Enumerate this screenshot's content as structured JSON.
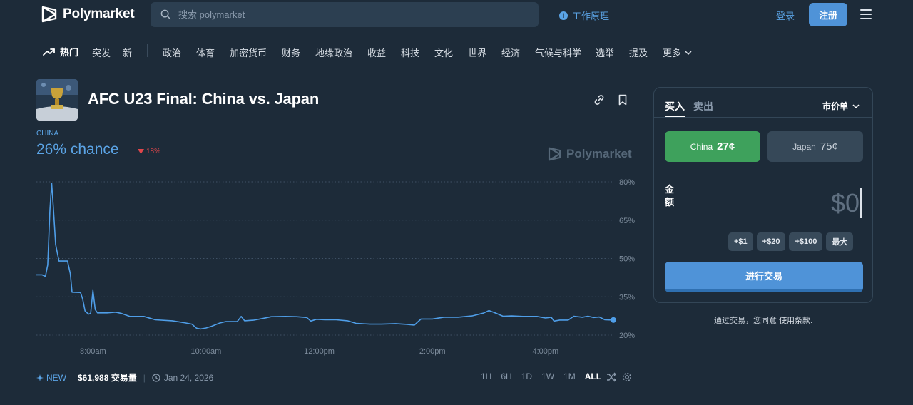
{
  "header": {
    "logo_text": "Polymarket",
    "search_placeholder": "搜索 polymarket",
    "how_it_works": "工作原理",
    "login": "登录",
    "signup": "注册"
  },
  "categories": {
    "hot": "热门",
    "items": [
      "突发",
      "新",
      "政治",
      "体育",
      "加密货币",
      "财务",
      "地缘政治",
      "收益",
      "科技",
      "文化",
      "世界",
      "经济",
      "气候与科学",
      "选举",
      "提及",
      "更多"
    ]
  },
  "market": {
    "title": "AFC U23 Final: China vs. Japan",
    "outcome": "CHINA",
    "chance": "26% chance",
    "delta": "18%",
    "watermark": "Polymarket",
    "new_label": "NEW",
    "volume": "$61,988 交易量",
    "date": "Jan 24, 2026",
    "ranges": [
      "1H",
      "6H",
      "1D",
      "1W",
      "1M",
      "ALL"
    ],
    "active_range": "ALL"
  },
  "chart_data": {
    "type": "line",
    "series": [
      {
        "color": "#4f9ee8",
        "points": [
          [
            7.0,
            43.6
          ],
          [
            7.1,
            43.6
          ],
          [
            7.16,
            43.0
          ],
          [
            7.2,
            47.5
          ],
          [
            7.24,
            69.0
          ],
          [
            7.27,
            79.5
          ],
          [
            7.3,
            70.0
          ],
          [
            7.34,
            55.5
          ],
          [
            7.4,
            49.0
          ],
          [
            7.55,
            49.0
          ],
          [
            7.6,
            44.0
          ],
          [
            7.63,
            36.8
          ],
          [
            7.78,
            36.7
          ],
          [
            7.82,
            34.0
          ],
          [
            7.86,
            29.5
          ],
          [
            7.92,
            28.2
          ],
          [
            7.96,
            28.5
          ],
          [
            8.0,
            37.5
          ],
          [
            8.04,
            30.0
          ],
          [
            8.08,
            28.7
          ],
          [
            8.25,
            28.7
          ],
          [
            8.4,
            29.0
          ],
          [
            8.5,
            28.5
          ],
          [
            8.65,
            27.3
          ],
          [
            8.9,
            27.3
          ],
          [
            9.1,
            26.0
          ],
          [
            9.4,
            25.6
          ],
          [
            9.6,
            24.9
          ],
          [
            9.75,
            24.3
          ],
          [
            9.83,
            22.7
          ],
          [
            9.9,
            22.4
          ],
          [
            10.0,
            22.8
          ],
          [
            10.1,
            23.5
          ],
          [
            10.25,
            24.8
          ],
          [
            10.35,
            25.3
          ],
          [
            10.55,
            25.3
          ],
          [
            10.62,
            27.3
          ],
          [
            10.68,
            25.6
          ],
          [
            10.85,
            25.9
          ],
          [
            11.0,
            26.5
          ],
          [
            11.15,
            27.2
          ],
          [
            11.4,
            27.3
          ],
          [
            11.6,
            27.2
          ],
          [
            11.78,
            26.9
          ],
          [
            11.85,
            25.5
          ],
          [
            11.95,
            26.2
          ],
          [
            12.1,
            26.0
          ],
          [
            12.3,
            26.0
          ],
          [
            12.5,
            25.6
          ],
          [
            12.65,
            24.6
          ],
          [
            12.9,
            24.3
          ],
          [
            13.1,
            24.3
          ],
          [
            13.35,
            24.5
          ],
          [
            13.55,
            24.2
          ],
          [
            13.68,
            23.9
          ],
          [
            13.8,
            26.3
          ],
          [
            14.0,
            26.3
          ],
          [
            14.2,
            27.0
          ],
          [
            14.45,
            27.0
          ],
          [
            14.7,
            27.5
          ],
          [
            14.9,
            28.6
          ],
          [
            15.0,
            29.6
          ],
          [
            15.1,
            28.8
          ],
          [
            15.25,
            27.4
          ],
          [
            15.4,
            27.5
          ],
          [
            15.6,
            27.3
          ],
          [
            15.85,
            27.3
          ],
          [
            16.0,
            26.7
          ],
          [
            16.1,
            27.0
          ],
          [
            16.15,
            25.5
          ],
          [
            16.25,
            25.9
          ],
          [
            16.4,
            25.9
          ],
          [
            16.5,
            27.4
          ],
          [
            16.65,
            27.0
          ],
          [
            16.75,
            27.4
          ],
          [
            16.85,
            26.9
          ],
          [
            16.95,
            27.1
          ],
          [
            17.05,
            26.0
          ],
          [
            17.2,
            25.9
          ]
        ]
      }
    ],
    "x_ticks": [
      {
        "label": "8:00am",
        "value": 8
      },
      {
        "label": "10:00am",
        "value": 10
      },
      {
        "label": "12:00pm",
        "value": 12
      },
      {
        "label": "2:00pm",
        "value": 14
      },
      {
        "label": "4:00pm",
        "value": 16
      }
    ],
    "y_ticks": [
      {
        "label": "80%",
        "value": 80
      },
      {
        "label": "65%",
        "value": 65
      },
      {
        "label": "50%",
        "value": 50
      },
      {
        "label": "35%",
        "value": 35
      },
      {
        "label": "20%",
        "value": 20
      }
    ],
    "xlim": [
      7.0,
      17.2
    ],
    "ylim": [
      20,
      80
    ],
    "grid": true,
    "last_value": 25.9
  },
  "trade": {
    "buy_tab": "买入",
    "sell_tab": "卖出",
    "order_type": "市价单",
    "outcome_yes": {
      "name": "China",
      "price": "27¢"
    },
    "outcome_no": {
      "name": "Japan",
      "price": "75¢"
    },
    "amount_label": "金额",
    "amount_value": "$0",
    "quick_amounts": [
      "+$1",
      "+$20",
      "+$100",
      "最大"
    ],
    "trade_button": "进行交易",
    "terms_prefix": "通过交易，您同意",
    "terms_link": "使用条款",
    "terms_suffix": "."
  },
  "colors": {
    "background": "#1d2b39",
    "accent": "#5ba4e6",
    "yes_green": "#3ea15c",
    "down_red": "#e0464b"
  }
}
